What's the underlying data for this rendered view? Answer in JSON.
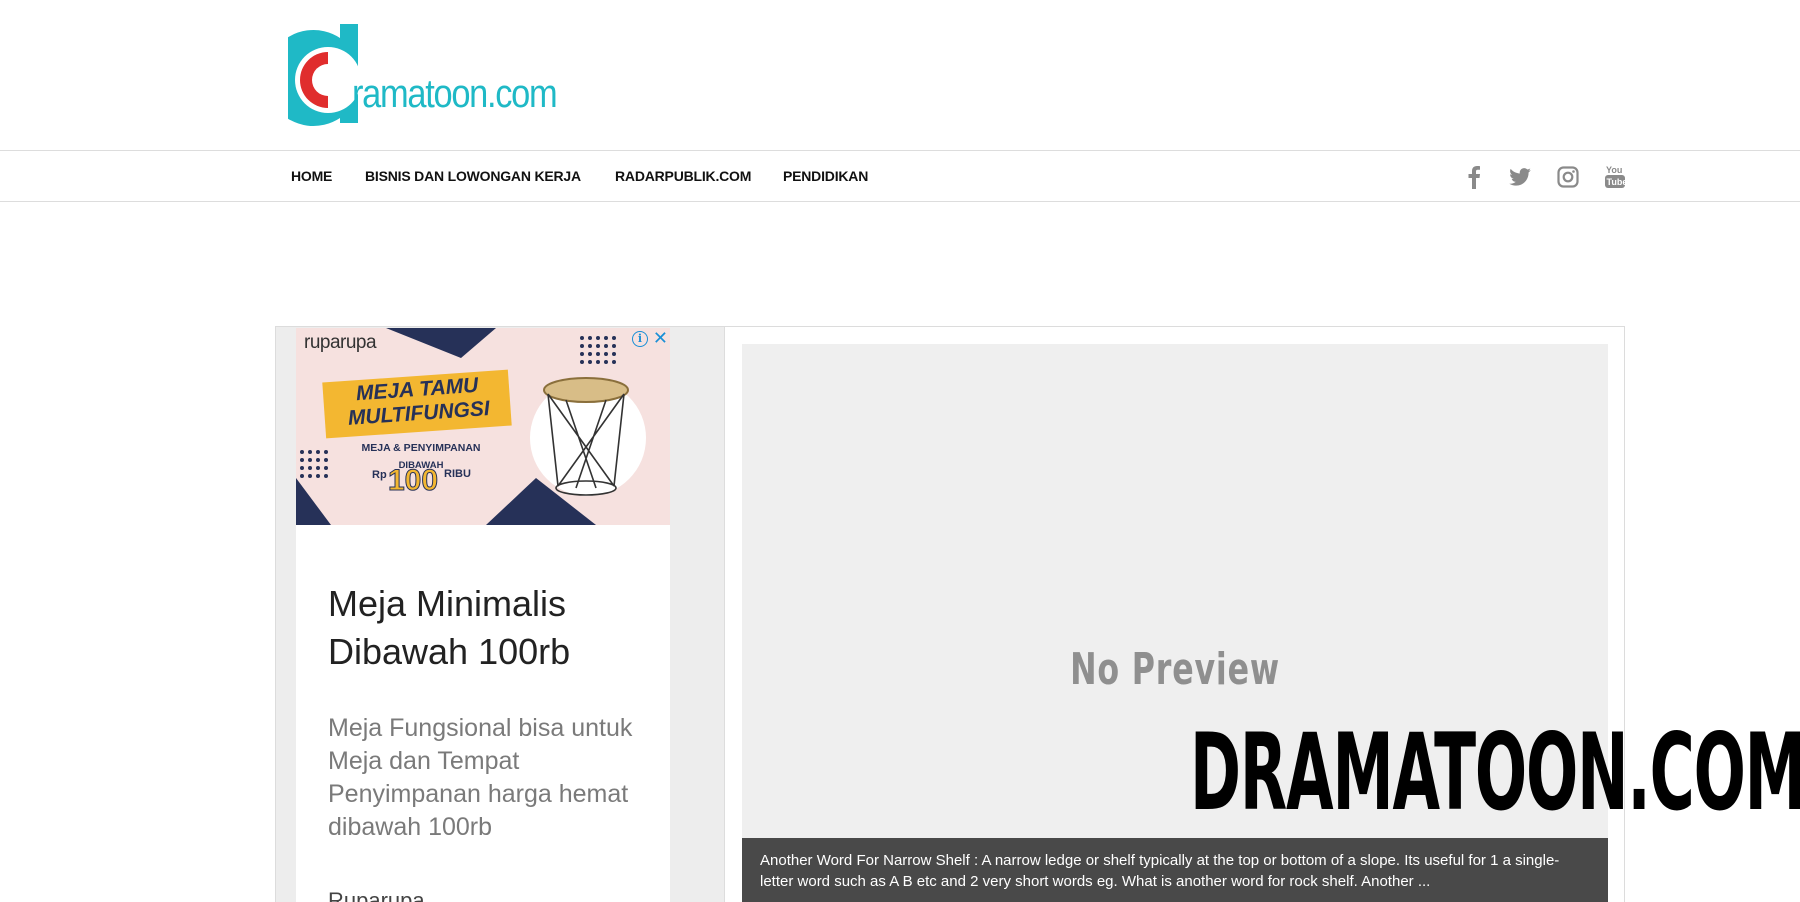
{
  "header": {
    "logo_text": "ramatoon.com",
    "brand_color": "#1fb9c6",
    "accent_color": "#e02d2d"
  },
  "nav": {
    "items": [
      {
        "label": "HOME"
      },
      {
        "label": "BISNIS DAN LOWONGAN KERJA"
      },
      {
        "label": "RADARPUBLIK.COM"
      },
      {
        "label": "PENDIDIKAN"
      }
    ],
    "social_icons": [
      "facebook-icon",
      "twitter-icon",
      "instagram-icon",
      "youtube-icon"
    ]
  },
  "ad": {
    "brand": "ruparupa",
    "headline": "MEJA TAMU MULTIFUNGSI",
    "subline": "MEJA & PENYIMPANAN",
    "subline2": "DIBAWAH",
    "price_prefix": "Rp",
    "price": "100",
    "price_suffix": "RIBU",
    "title": "Meja Minimalis Dibawah 100rb",
    "description": "Meja Fungsional bisa untuk Meja dan Tempat Penyimpanan harga hemat dibawah 100rb",
    "advertiser": "Ruparupa"
  },
  "preview": {
    "placeholder": "No Preview",
    "caption": "Another Word For Narrow Shelf : A narrow ledge or shelf typically at the top or bottom of a slope. Its useful for 1 a single-letter word such as A B etc and 2 very short words eg. What is another word for rock shelf. Another ..."
  },
  "watermark": "DRAMATOON.COM"
}
